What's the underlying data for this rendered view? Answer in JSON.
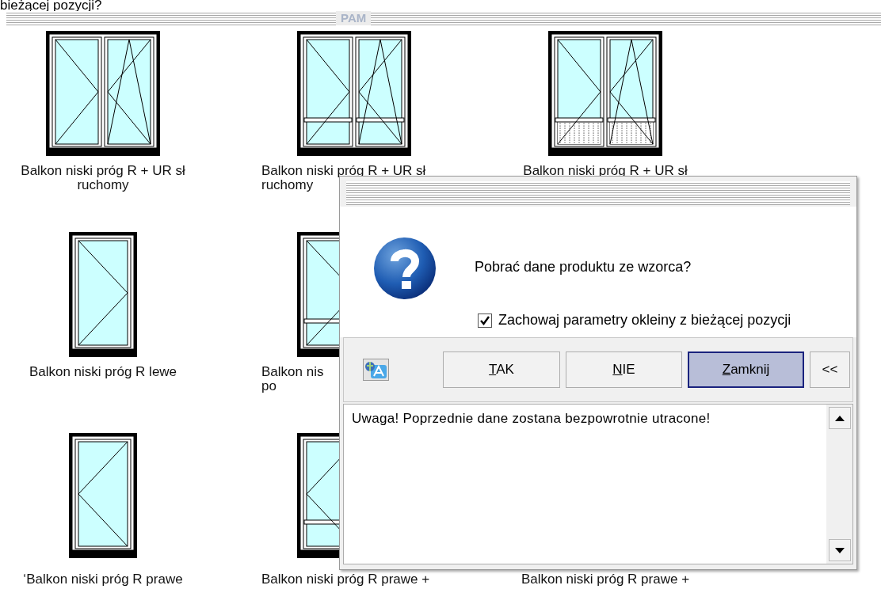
{
  "top_text": "bieżącej pozycji?",
  "section": {
    "title": "PAM"
  },
  "rows": [
    [
      {
        "kind": "double",
        "lines": [
          "Balkon niski próg R + UR sł",
          "ruchomy"
        ]
      },
      {
        "kind": "double-transom",
        "lines": [
          "Balkon niski próg R + UR sł",
          "ruchomy"
        ]
      },
      {
        "kind": "double-panel",
        "lines": [
          "Balkon niski próg R + UR sł"
        ]
      }
    ],
    [
      {
        "kind": "single-left",
        "lines": [
          "Balkon niski próg R lewe"
        ]
      },
      {
        "kind": "single-left-transom",
        "lines": [
          "Balkon nis",
          "po"
        ]
      }
    ],
    [
      {
        "kind": "single-right",
        "lines": [
          "‘Balkon niski próg R prawe"
        ]
      },
      {
        "kind": "single-right-transom",
        "lines": [
          "Balkon niski próg R prawe +"
        ]
      },
      {
        "lines": [
          "Balkon niski próg R prawe +"
        ]
      }
    ]
  ],
  "dialog": {
    "message": "Pobrać dane produktu ze wzorca?",
    "checkbox": {
      "label": "Zachowaj parametry okleiny z bieżącej pozycji",
      "checked": true
    },
    "buttons": [
      {
        "label": "TAK",
        "mnemonic": true,
        "default": false
      },
      {
        "label": "NIE",
        "mnemonic": true,
        "default": false
      },
      {
        "label": "Zamknij",
        "mnemonic": true,
        "default": true
      },
      {
        "label": "<<",
        "mnemonic": false,
        "default": false
      }
    ],
    "details": "Uwaga! Poprzednie dane zostana bezpowrotnie utracone!"
  }
}
